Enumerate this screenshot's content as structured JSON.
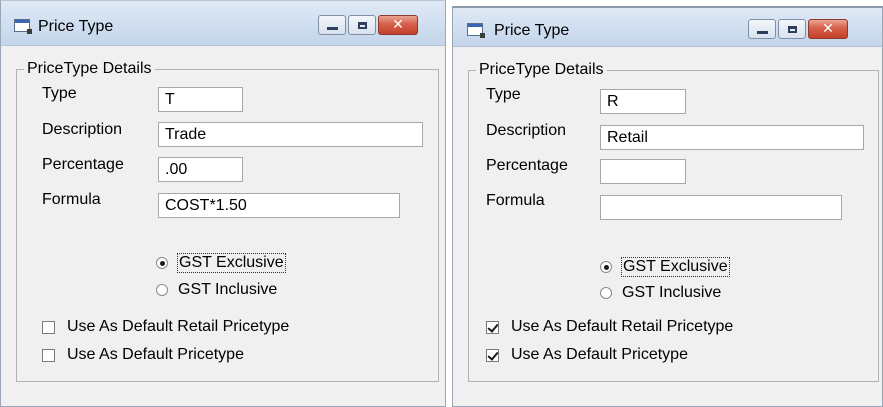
{
  "windows": [
    {
      "title": "Price Type",
      "group_legend": "PriceType Details",
      "fields": {
        "type": {
          "label": "Type",
          "value": "T"
        },
        "description": {
          "label": "Description",
          "value": "Trade"
        },
        "percentage": {
          "label": "Percentage",
          "value": ".00"
        },
        "formula": {
          "label": "Formula",
          "value": "COST*1.50"
        }
      },
      "radios": [
        {
          "label": "GST Exclusive",
          "selected": true
        },
        {
          "label": "GST Inclusive",
          "selected": false
        }
      ],
      "checkboxes": [
        {
          "label": "Use As Default Retail Pricetype",
          "checked": false
        },
        {
          "label": "Use As Default Pricetype",
          "checked": false
        }
      ]
    },
    {
      "title": "Price Type",
      "group_legend": "PriceType Details",
      "fields": {
        "type": {
          "label": "Type",
          "value": "R"
        },
        "description": {
          "label": "Description",
          "value": "Retail"
        },
        "percentage": {
          "label": "Percentage",
          "value": ""
        },
        "formula": {
          "label": "Formula",
          "value": ""
        }
      },
      "radios": [
        {
          "label": "GST Exclusive",
          "selected": true
        },
        {
          "label": "GST Inclusive",
          "selected": false
        }
      ],
      "checkboxes": [
        {
          "label": "Use As Default Retail Pricetype",
          "checked": true
        },
        {
          "label": "Use As Default Pricetype",
          "checked": true
        }
      ]
    }
  ]
}
